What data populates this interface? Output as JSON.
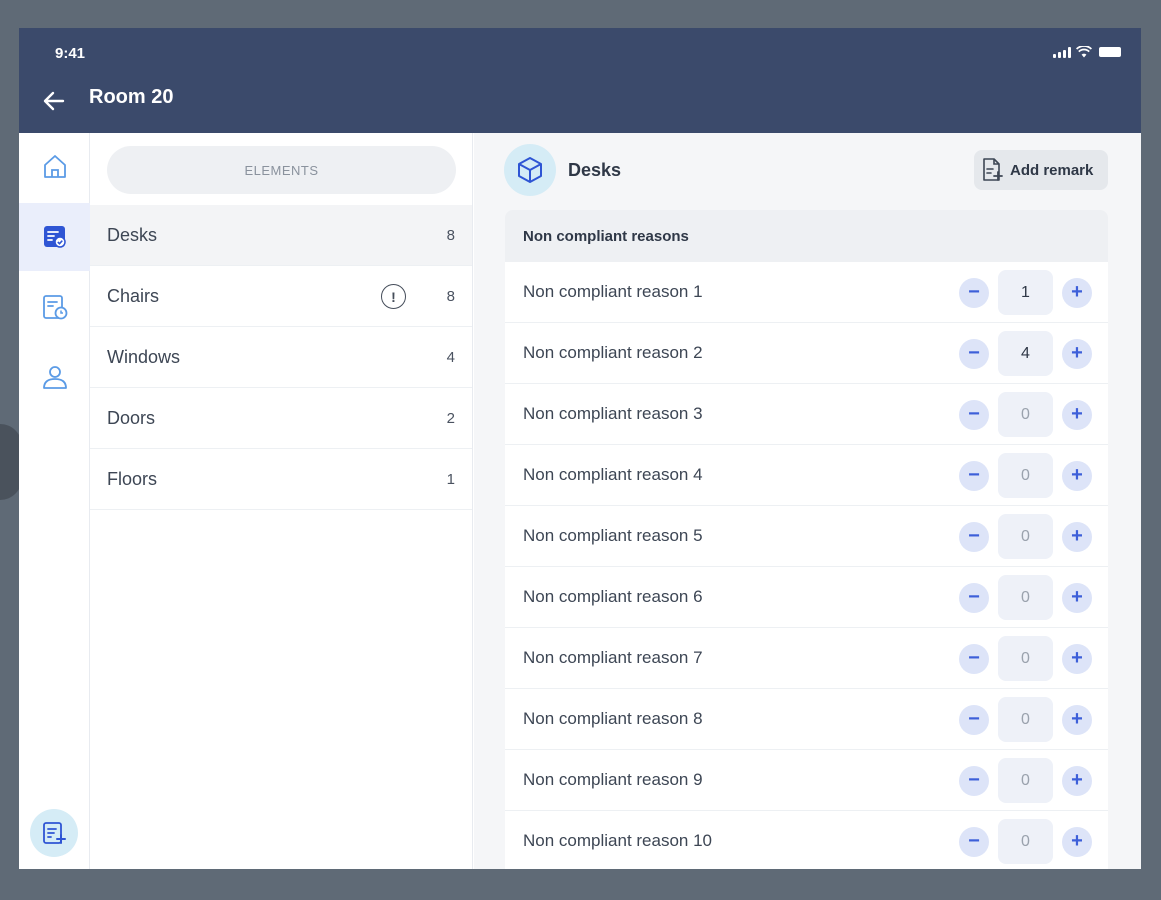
{
  "status_bar": {
    "time": "9:41"
  },
  "header": {
    "title": "Room 20"
  },
  "rail": {
    "items": [
      {
        "icon": "home-icon"
      },
      {
        "icon": "checklist-icon",
        "active": true
      },
      {
        "icon": "schedule-doc-icon"
      },
      {
        "icon": "user-icon"
      }
    ],
    "fab_icon": "add-list-icon"
  },
  "elements": {
    "tab_label": "ELEMENTS",
    "items": [
      {
        "label": "Desks",
        "count": "8",
        "active": true,
        "warning": false
      },
      {
        "label": "Chairs",
        "count": "8",
        "active": false,
        "warning": true
      },
      {
        "label": "Windows",
        "count": "4",
        "active": false,
        "warning": false
      },
      {
        "label": "Doors",
        "count": "2",
        "active": false,
        "warning": false
      },
      {
        "label": "Floors",
        "count": "1",
        "active": false,
        "warning": false
      }
    ],
    "warning_glyph": "!"
  },
  "detail": {
    "title": "Desks",
    "add_remark_label": "Add remark",
    "table_header": "Non compliant reasons",
    "minus_glyph": "−",
    "plus_glyph": "+",
    "reasons": [
      {
        "label": "Non compliant reason 1",
        "value": "1"
      },
      {
        "label": "Non compliant reason 2",
        "value": "4"
      },
      {
        "label": "Non compliant reason 3",
        "value": "0"
      },
      {
        "label": "Non compliant reason 4",
        "value": "0"
      },
      {
        "label": "Non compliant reason 5",
        "value": "0"
      },
      {
        "label": "Non compliant reason 6",
        "value": "0"
      },
      {
        "label": "Non compliant reason 7",
        "value": "0"
      },
      {
        "label": "Non compliant reason 8",
        "value": "0"
      },
      {
        "label": "Non compliant reason 9",
        "value": "0"
      },
      {
        "label": "Non compliant reason 10",
        "value": "0"
      }
    ]
  },
  "colors": {
    "header_bg": "#3b4a6b",
    "accent": "#3d5fd9",
    "icon_light_blue": "#5b9be6",
    "page_bg": "#5f6a76"
  }
}
